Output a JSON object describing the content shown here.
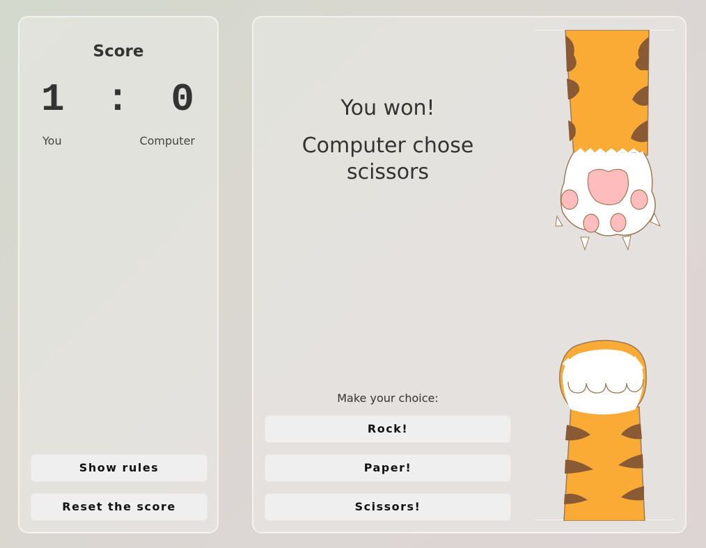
{
  "score": {
    "title": "Score",
    "player_score": "1",
    "separator": ":",
    "computer_score": "0",
    "player_label": "You",
    "computer_label": "Computer",
    "show_rules_label": "Show rules",
    "reset_label": "Reset the score"
  },
  "game": {
    "result": "You won!",
    "computer_choice": "Computer chose scissors",
    "prompt": "Make your choice:",
    "choices": [
      "Rock!",
      "Paper!",
      "Scissors!"
    ]
  },
  "colors": {
    "fur_orange": "#f9ab35",
    "fur_stripe": "#8a5a34",
    "paw_white": "#ffffff",
    "paw_pad": "#ffbcbc",
    "outline": "#9b7a58",
    "button_bg": "#efefef",
    "text": "#333333"
  },
  "icons": {
    "top_paw": "cat-paw-extended-claws-illustration",
    "bottom_paw": "cat-paw-closed-illustration"
  }
}
